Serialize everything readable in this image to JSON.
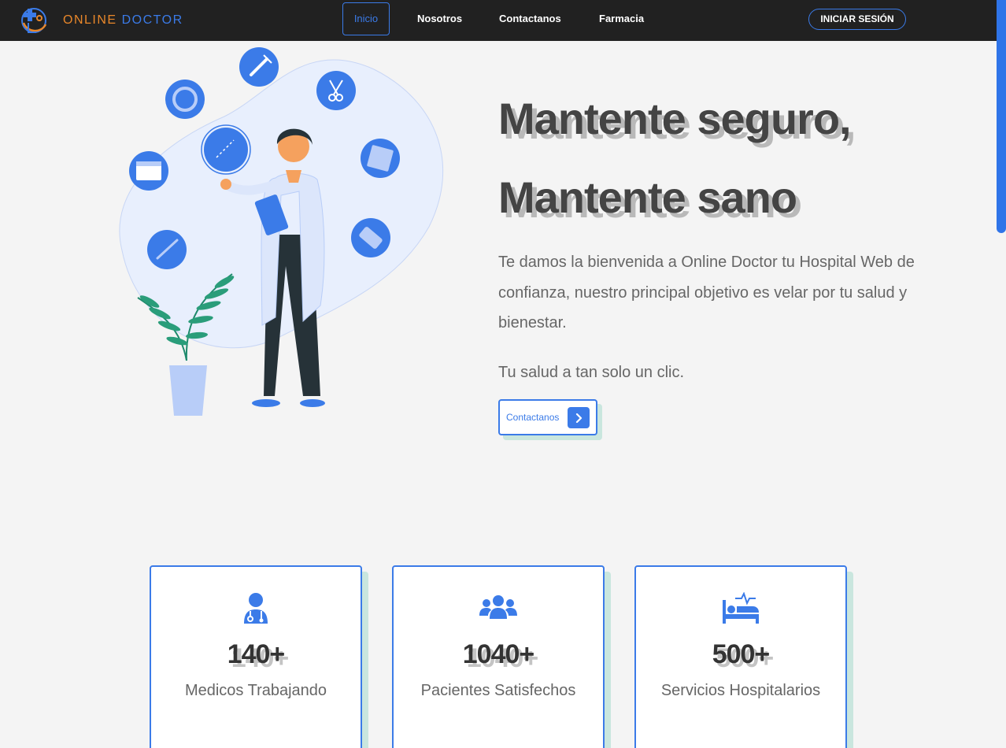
{
  "brand": {
    "word1": "ONLINE",
    "word2": "DOCTOR",
    "logo_icon": "stethoscope-cross-logo"
  },
  "nav": {
    "items": [
      {
        "label": "Inicio",
        "active": true
      },
      {
        "label": "Nosotros"
      },
      {
        "label": "Contactanos"
      },
      {
        "label": "Farmacia"
      }
    ],
    "login_label": "INICIAR SESIÓN"
  },
  "hero": {
    "title_line1": "Mantente seguro,",
    "title_line2": "Mantente sano",
    "paragraph1": "Te damos la bienvenida a Online Doctor tu Hospital Web de confianza, nuestro principal objetivo es velar por tu salud y bienestar.",
    "paragraph2": "Tu salud a tan solo un clic.",
    "cta_label": "Contactanos",
    "illustration": "doctor-with-clipboard-illustration"
  },
  "stats": [
    {
      "value": "140+",
      "label": "Medicos Trabajando",
      "icon": "doctor-icon"
    },
    {
      "value": "1040+",
      "label": "Pacientes Satisfechos",
      "icon": "users-icon"
    },
    {
      "value": "500+",
      "label": "Servicios Hospitalarios",
      "icon": "hospital-bed-icon"
    }
  ],
  "colors": {
    "accent": "#3b7be8",
    "brand_orange": "#e9872a",
    "navbar_bg": "#212121",
    "page_bg": "#f4f4f4",
    "card_shadow": "#c9e6de"
  }
}
